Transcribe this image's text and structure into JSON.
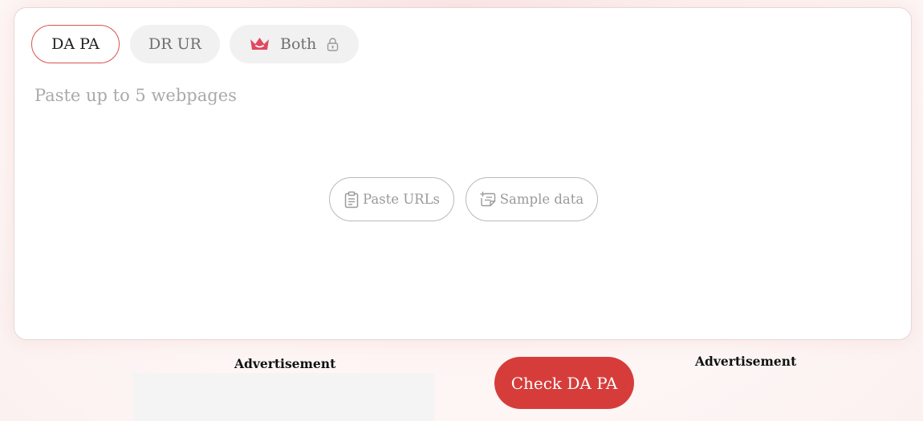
{
  "tabs": {
    "dapa": "DA PA",
    "drur": "DR UR",
    "both": "Both"
  },
  "input": {
    "placeholder": "Paste up to 5 webpages"
  },
  "actions": {
    "paste_urls": "Paste URLs",
    "sample_data": "Sample data"
  },
  "ads": {
    "left_label": "Advertisement",
    "right_label": "Advertisement"
  },
  "submit": {
    "label": "Check DA PA"
  },
  "colors": {
    "accent": "#d63d3a",
    "crown": "#e0485f",
    "tab_inactive_bg": "#f1f1f1"
  },
  "icons": {
    "both_tab_leading": "crown-icon",
    "both_tab_trailing": "lock-icon",
    "paste_urls": "clipboard-icon",
    "sample_data": "sample-document-icon"
  }
}
